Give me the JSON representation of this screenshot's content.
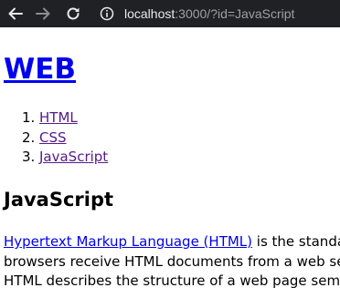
{
  "browser": {
    "url_host": "localhost",
    "url_rest": ":3000/?id=JavaScript",
    "colors": {
      "toolbar_bg": "#202124",
      "icon_active": "#e8eaed",
      "icon_disabled": "#8a8d91",
      "url_host": "#e8eaed",
      "url_rest": "#9aa0a6"
    },
    "icons": {
      "back": "back-arrow-icon",
      "forward": "forward-arrow-icon",
      "reload": "reload-icon",
      "info": "info-icon"
    }
  },
  "page": {
    "site_title": "WEB",
    "nav": [
      {
        "number": "1.",
        "label": "HTML"
      },
      {
        "number": "2.",
        "label": "CSS"
      },
      {
        "number": "3.",
        "label": "JavaScript"
      }
    ],
    "heading": "JavaScript",
    "description": {
      "link_text": "Hypertext Markup Language (HTML)",
      "line1_rest": " is the standard markup language for creating web pages and web applications.",
      "line2": "browsers receive HTML documents from a web server or from local storage and render",
      "line3": "HTML describes the structure of a web page semantically and originally included cues"
    },
    "colors": {
      "link": "#0000ee",
      "visited_link": "#551a8b",
      "text": "#000000"
    }
  }
}
